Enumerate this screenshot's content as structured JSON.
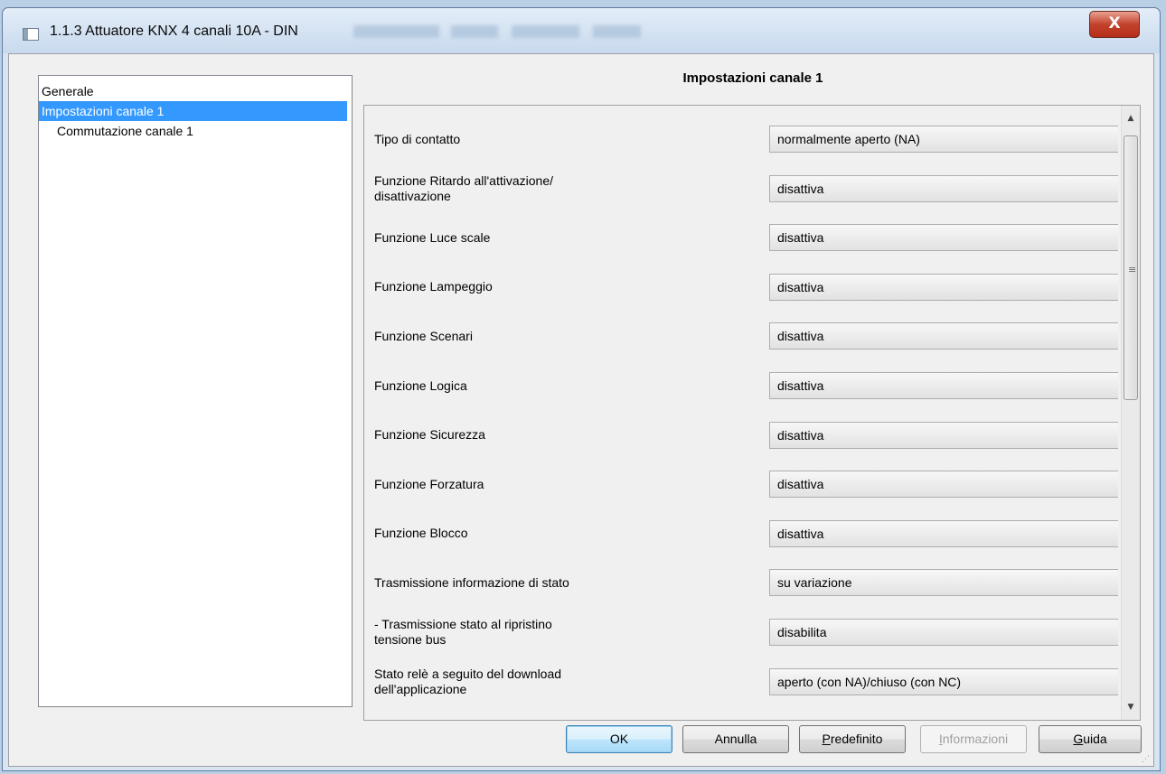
{
  "window": {
    "title": "1.1.3 Attuatore KNX 4 canali 10A - DIN",
    "close_label": "X"
  },
  "tree": {
    "items": [
      {
        "label": "Generale"
      },
      {
        "label": "Impostazioni canale 1"
      },
      {
        "label": "Commutazione canale 1"
      }
    ]
  },
  "panel": {
    "title": "Impostazioni canale 1",
    "params": [
      {
        "label": "Tipo di contatto",
        "value": "normalmente aperto (NA)"
      },
      {
        "label": "Funzione Ritardo all'attivazione/\ndisattivazione",
        "value": "disattiva"
      },
      {
        "label": "Funzione Luce scale",
        "value": "disattiva"
      },
      {
        "label": "Funzione Lampeggio",
        "value": "disattiva"
      },
      {
        "label": "Funzione Scenari",
        "value": "disattiva"
      },
      {
        "label": "Funzione Logica",
        "value": "disattiva"
      },
      {
        "label": "Funzione Sicurezza",
        "value": "disattiva"
      },
      {
        "label": "Funzione Forzatura",
        "value": "disattiva"
      },
      {
        "label": "Funzione Blocco",
        "value": "disattiva"
      },
      {
        "label": "Trasmissione informazione di stato",
        "value": "su variazione"
      },
      {
        "label": "- Trasmissione stato al ripristino\n  tensione bus",
        "value": "disabilita"
      },
      {
        "label": "Stato relè a seguito del download\ndell'applicazione",
        "value": "aperto (con NA)/chiuso (con NC)"
      }
    ]
  },
  "buttons": {
    "ok": "OK",
    "annulla": "Annulla",
    "predefinito_mn": "P",
    "predefinito_rest": "redefinito",
    "informazioni_mn": "I",
    "informazioni_rest": "nformazioni",
    "guida_mn": "G",
    "guida_rest": "uida"
  },
  "colors": {
    "selection": "#3399ff",
    "dialog_bg": "#f0f0f0",
    "close_button": "#c2432d"
  }
}
